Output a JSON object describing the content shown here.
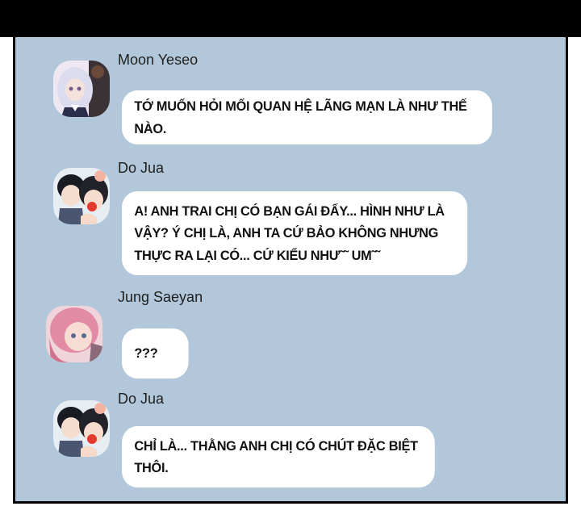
{
  "colors": {
    "top_bar": "#000000",
    "chat_background": "#b2c7da",
    "bubble": "#ffffff"
  },
  "messages": [
    {
      "sender": "Moon Yeseo",
      "avatar_icon": "silver-hair-girl-avatar-icon",
      "text": "TỚ MUỐN HỎI MỐI QUAN HỆ LÃNG MẠN LÀ NHƯ THẾ NÀO."
    },
    {
      "sender": "Do Jua",
      "avatar_icon": "boy-and-girl-avatar-icon",
      "text": "A! ANH TRAI CHỊ CÓ BẠN GÁI ĐẤY... HÌNH NHƯ LÀ VẬY? Ý CHỊ LÀ, ANH TA CỨ BẢO KHÔNG NHƯNG THỰC RA LẠI CÓ... CỨ KIỂU NHƯ˜˜ UM˜˜"
    },
    {
      "sender": "Jung Saeyan",
      "avatar_icon": "pink-hair-girl-avatar-icon",
      "text": "???"
    },
    {
      "sender": "Do Jua",
      "avatar_icon": "boy-and-girl-avatar-icon",
      "text": "CHỈ LÀ... THẰNG ANH CHỊ CÓ CHÚT ĐẶC BIỆT THÔI."
    }
  ]
}
